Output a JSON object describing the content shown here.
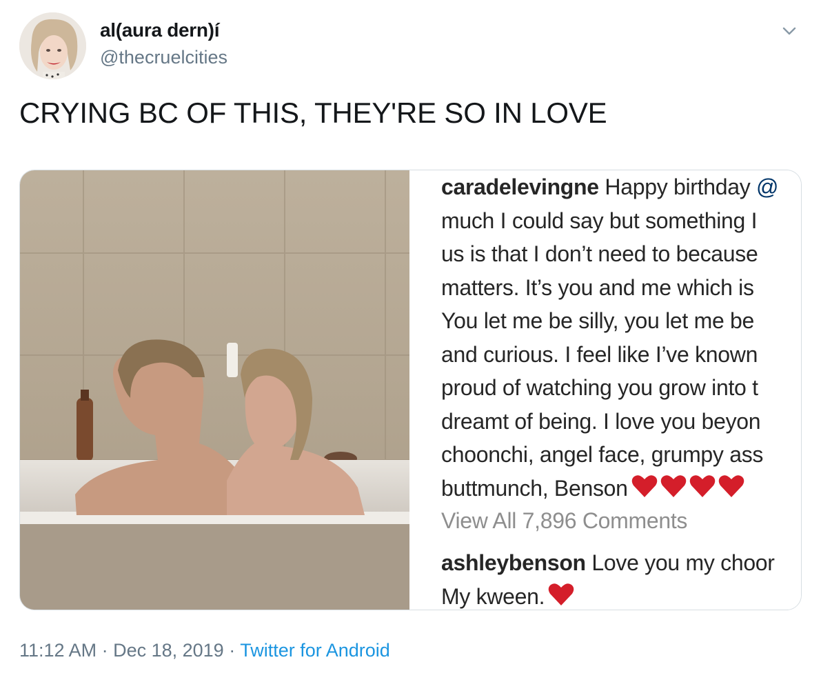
{
  "author": {
    "display_name": "al(aura dern)í",
    "handle": "@thecruelcities"
  },
  "tweet": {
    "text": "CRYING BC OF THIS, THEY'RE SO IN LOVE"
  },
  "caption": {
    "username": "caradelevingne",
    "line1_rest": " Happy birthday ",
    "line1_mention": "@",
    "line2": "much I could say but something I",
    "line3": "us is that I don’t need to because",
    "line4": "matters. It’s you and me which is",
    "line5": "You let me be silly, you let me be",
    "line6": "and curious. I feel like I’ve known",
    "line7": "proud of watching you grow into t",
    "line8": "dreamt of being. I love you beyon",
    "line9": "choonchi, angel face, grumpy ass",
    "line10": "buttmunch, Benson",
    "view_all": "View All 7,896 Comments"
  },
  "reply": {
    "username": "ashleybenson",
    "line1_rest": " Love you my choor",
    "line2": "My kween."
  },
  "meta": {
    "time": "11:12 AM",
    "separator1": " · ",
    "date": "Dec 18, 2019",
    "separator2": " · ",
    "source": "Twitter for Android"
  },
  "colors": {
    "heart": "#d41e2a",
    "link": "#1b95e0",
    "muted": "#657786"
  }
}
